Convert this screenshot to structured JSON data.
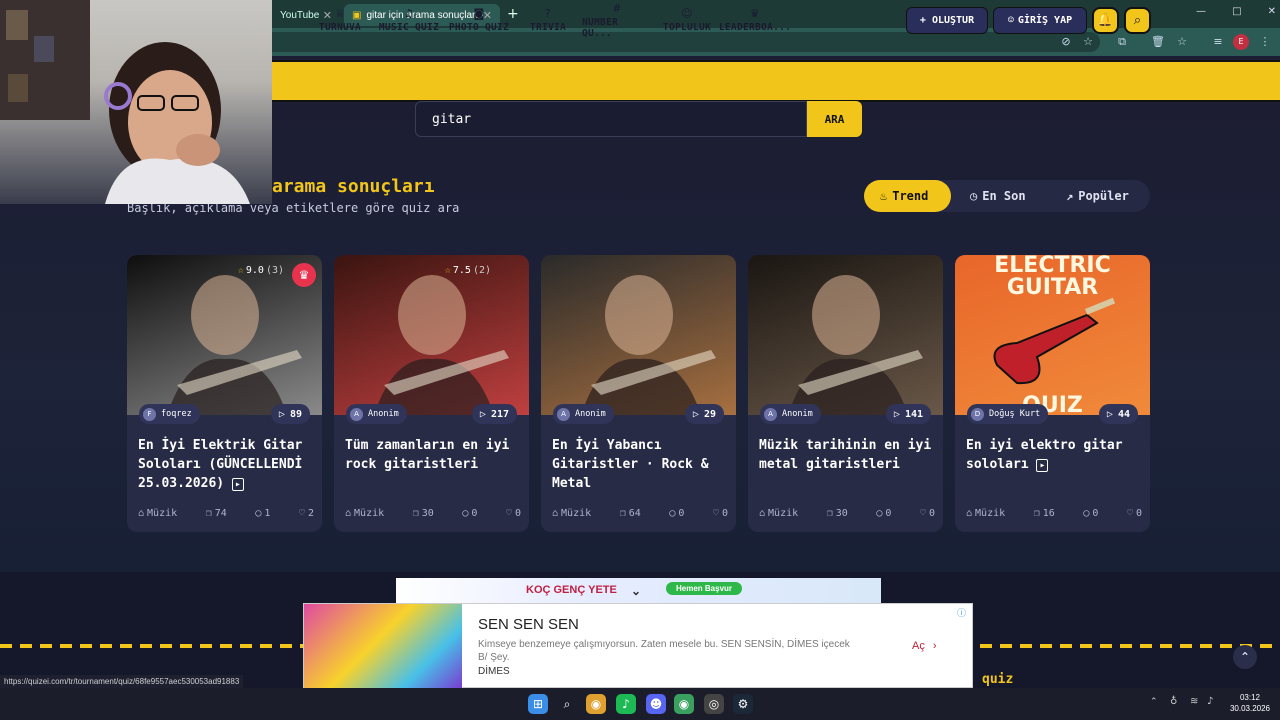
{
  "browser": {
    "tabs": [
      {
        "label": "YouTube"
      },
      {
        "label": "gitar için arama sonuçları - Qui..."
      }
    ],
    "new_tab": "+",
    "window_controls": [
      "—",
      "□",
      "✕"
    ]
  },
  "nav": {
    "items": [
      {
        "label": "TURNUVA",
        "icon": "trophy-icon",
        "glyph": "♕"
      },
      {
        "label": "MUSIC QUIZ",
        "icon": "music-icon",
        "glyph": "♫"
      },
      {
        "label": "PHOTO QUIZ",
        "icon": "camera-icon",
        "glyph": "◙"
      },
      {
        "label": "TRIVIA",
        "icon": "question-icon",
        "glyph": "?"
      },
      {
        "label": "NUMBER QU...",
        "icon": "hash-icon",
        "glyph": "#"
      },
      {
        "label": "TOPLULUK",
        "icon": "users-icon",
        "glyph": "☺"
      },
      {
        "label": "LEADERBOA...",
        "icon": "medal-icon",
        "glyph": "♛"
      }
    ],
    "create_label": "+ OLUŞTUR",
    "login_label": "GİRİŞ YAP"
  },
  "search": {
    "value": "gitar",
    "button": "ARA"
  },
  "page": {
    "title": "arama sonuçları",
    "subtitle": "Başlık, açıklama veya etiketlere göre quiz ara"
  },
  "sort": {
    "options": [
      {
        "label": "Trend",
        "active": true
      },
      {
        "label": "En Son",
        "active": false
      },
      {
        "label": "Popüler",
        "active": false
      }
    ]
  },
  "cards": [
    {
      "title": "En İyi Elektrik Gitar Soloları (GÜNCELLENDİ 25.03.2026)",
      "video": true,
      "rating": "9.0",
      "rating_count": "(3)",
      "crown": true,
      "author": "foqrez",
      "author_initial": "F",
      "plays": "89",
      "category": "Müzik",
      "questions": "74",
      "comments": "1",
      "likes": "2",
      "colors": [
        "#0e0e0e",
        "#8a8a8a"
      ]
    },
    {
      "title": "Tüm zamanların en iyi rock gitaristleri",
      "video": false,
      "rating": "7.5",
      "rating_count": "(2)",
      "crown": false,
      "author": "Anonim",
      "author_initial": "A",
      "plays": "217",
      "category": "Müzik",
      "questions": "30",
      "comments": "0",
      "likes": "0",
      "colors": [
        "#3a1410",
        "#c04040"
      ]
    },
    {
      "title": "En İyi Yabancı Gitaristler · Rock & Metal",
      "video": false,
      "rating": "",
      "rating_count": "",
      "crown": false,
      "author": "Anonim",
      "author_initial": "A",
      "plays": "29",
      "category": "Müzik",
      "questions": "64",
      "comments": "0",
      "likes": "0",
      "colors": [
        "#2a2a2a",
        "#a87040"
      ]
    },
    {
      "title": "Müzik tarihinin en iyi metal gitaristleri",
      "video": false,
      "rating": "",
      "rating_count": "",
      "crown": false,
      "author": "Anonim",
      "author_initial": "A",
      "plays": "141",
      "category": "Müzik",
      "questions": "30",
      "comments": "0",
      "likes": "0",
      "colors": [
        "#1a1612",
        "#6a5848"
      ]
    },
    {
      "title": "En iyi elektro gitar soloları",
      "video": true,
      "rating": "",
      "rating_count": "",
      "crown": false,
      "author": "Doğuş Kurt",
      "author_initial": "D",
      "plays": "44",
      "category": "Müzik",
      "questions": "16",
      "comments": "0",
      "likes": "0",
      "colors": [
        "#e8662a",
        "#f08a3a"
      ],
      "thumb_text": "ELECTRIC GUITAR",
      "thumb_text2": "QUIZ"
    }
  ],
  "ads": {
    "banner_text": "KOÇ GENÇ YETE",
    "banner_cta": "Hemen Başvur",
    "title": "SEN SEN SEN",
    "text": "Kimseye benzemeye çalışmıyorsun. Zaten mesele bu. SEN SENSİN, DİMES içecek B/ Şey.",
    "brand": "DİMES",
    "cta": "Aç"
  },
  "footer": {
    "quiz_label": "quiz"
  },
  "status_url": "https://quizei.com/tr/tournament/quiz/68fe9557aec530053ad91883",
  "taskbar": {
    "time": "03:12",
    "date": "30.03.2026",
    "apps": [
      {
        "name": "windows-start-icon",
        "glyph": "⊞",
        "color": "#3a8ee8"
      },
      {
        "name": "search-icon",
        "glyph": "⌕",
        "color": "transparent"
      },
      {
        "name": "chrome-icon",
        "glyph": "◉",
        "color": "#e0a030"
      },
      {
        "name": "spotify-icon",
        "glyph": "♪",
        "color": "#1db954"
      },
      {
        "name": "discord-icon",
        "glyph": "☻",
        "color": "#5865f2"
      },
      {
        "name": "chrome-profile-icon",
        "glyph": "◉",
        "color": "#3aa060"
      },
      {
        "name": "obs-icon",
        "glyph": "◎",
        "color": "#444"
      },
      {
        "name": "steam-icon",
        "glyph": "⚙",
        "color": "#1b2838"
      }
    ]
  }
}
